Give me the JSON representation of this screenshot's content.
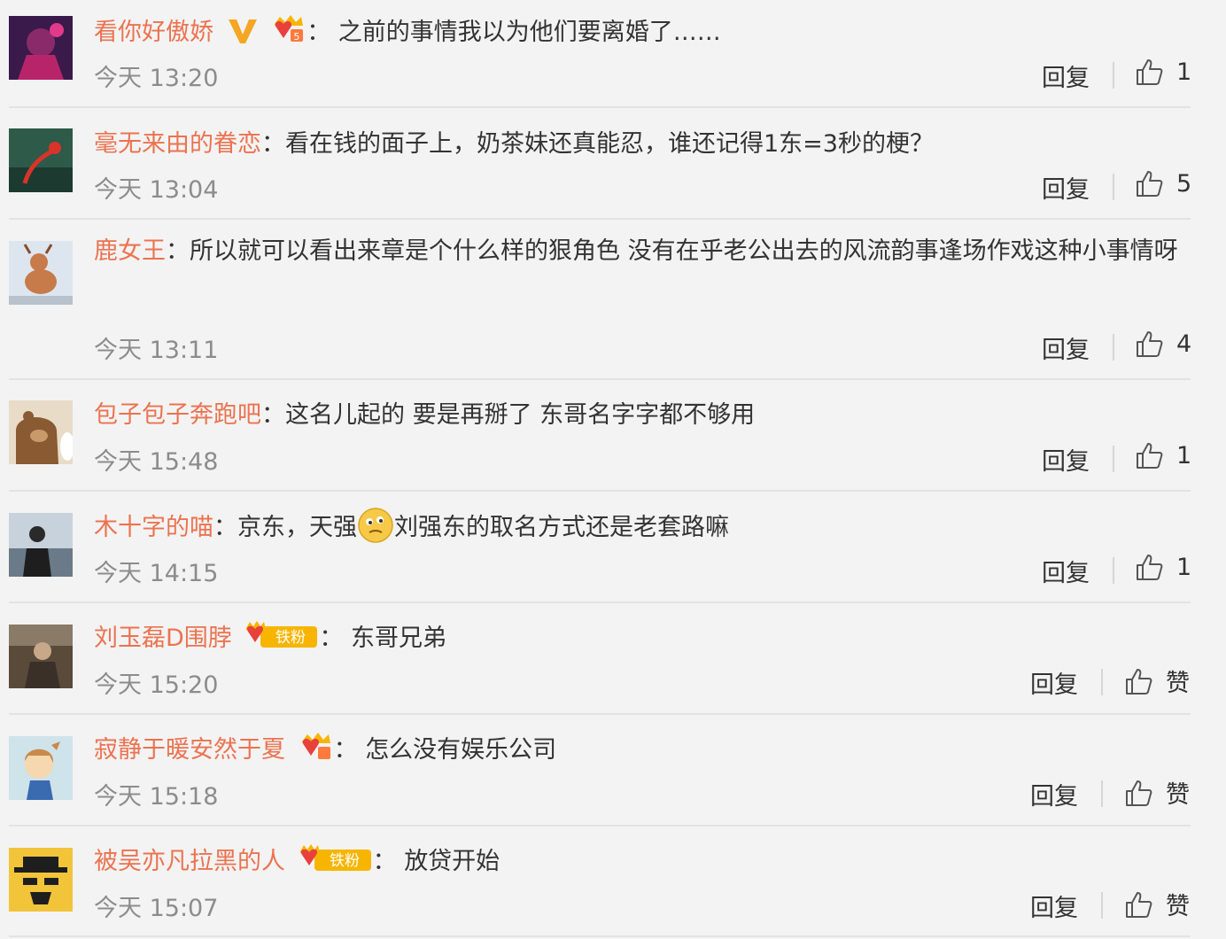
{
  "comments": [
    {
      "username": "看你好傲娇",
      "badges": [
        "verified-v-icon",
        "vip-crown-badge-icon"
      ],
      "separator": "：",
      "text": "之前的事情我以为他们要离婚了……",
      "time": "今天 13:20",
      "reply_label": "回复",
      "likes": "1"
    },
    {
      "username": "毫无来由的眷恋",
      "badges": [],
      "separator": "：",
      "text": "看在钱的面子上，奶茶妹还真能忍，谁还记得1东=3秒的梗？",
      "time": "今天 13:04",
      "reply_label": "回复",
      "likes": "5"
    },
    {
      "username": "鹿女王",
      "badges": [],
      "separator": "：",
      "text": "所以就可以看出来章是个什么样的狠角色 没有在乎老公出去的风流韵事逢场作戏这种小事情呀",
      "time": "今天 13:11",
      "reply_label": "回复",
      "likes": "4"
    },
    {
      "username": "包子包子奔跑吧",
      "badges": [],
      "separator": "：",
      "text": "这名儿起的 要是再掰了 东哥名字字都不够用",
      "time": "今天 15:48",
      "reply_label": "回复",
      "likes": "1"
    },
    {
      "username": "木十字的喵",
      "badges": [],
      "separator": "：",
      "text_before_emoji": "京东，天强",
      "emoji": "thinking-face-emoji",
      "text_after_emoji": "刘强东的取名方式还是老套路嘛",
      "time": "今天 14:15",
      "reply_label": "回复",
      "likes": "1"
    },
    {
      "username": "刘玉磊D围脖",
      "badges": [
        "tiefen-fan-badge-icon"
      ],
      "badge_text": "铁粉",
      "separator": "：",
      "text": "东哥兄弟",
      "time": "今天 15:20",
      "reply_label": "回复",
      "likes": "赞"
    },
    {
      "username": "寂静于暖安然于夏",
      "badges": [
        "vip-crown-badge-icon"
      ],
      "separator": "：",
      "text": "怎么没有娱乐公司",
      "time": "今天 15:18",
      "reply_label": "回复",
      "likes": "赞"
    },
    {
      "username": "被吴亦凡拉黑的人",
      "badges": [
        "tiefen-fan-badge-icon"
      ],
      "badge_text": "铁粉",
      "separator": "：",
      "text": "放贷开始",
      "time": "今天 15:07",
      "reply_label": "回复",
      "likes": "赞"
    }
  ],
  "colors": {
    "background": "#f3f3f3",
    "username": "#eb7350",
    "text": "#333333",
    "time": "#8c8c8c",
    "verified": "#f5a623",
    "badge": "#f7b500"
  }
}
